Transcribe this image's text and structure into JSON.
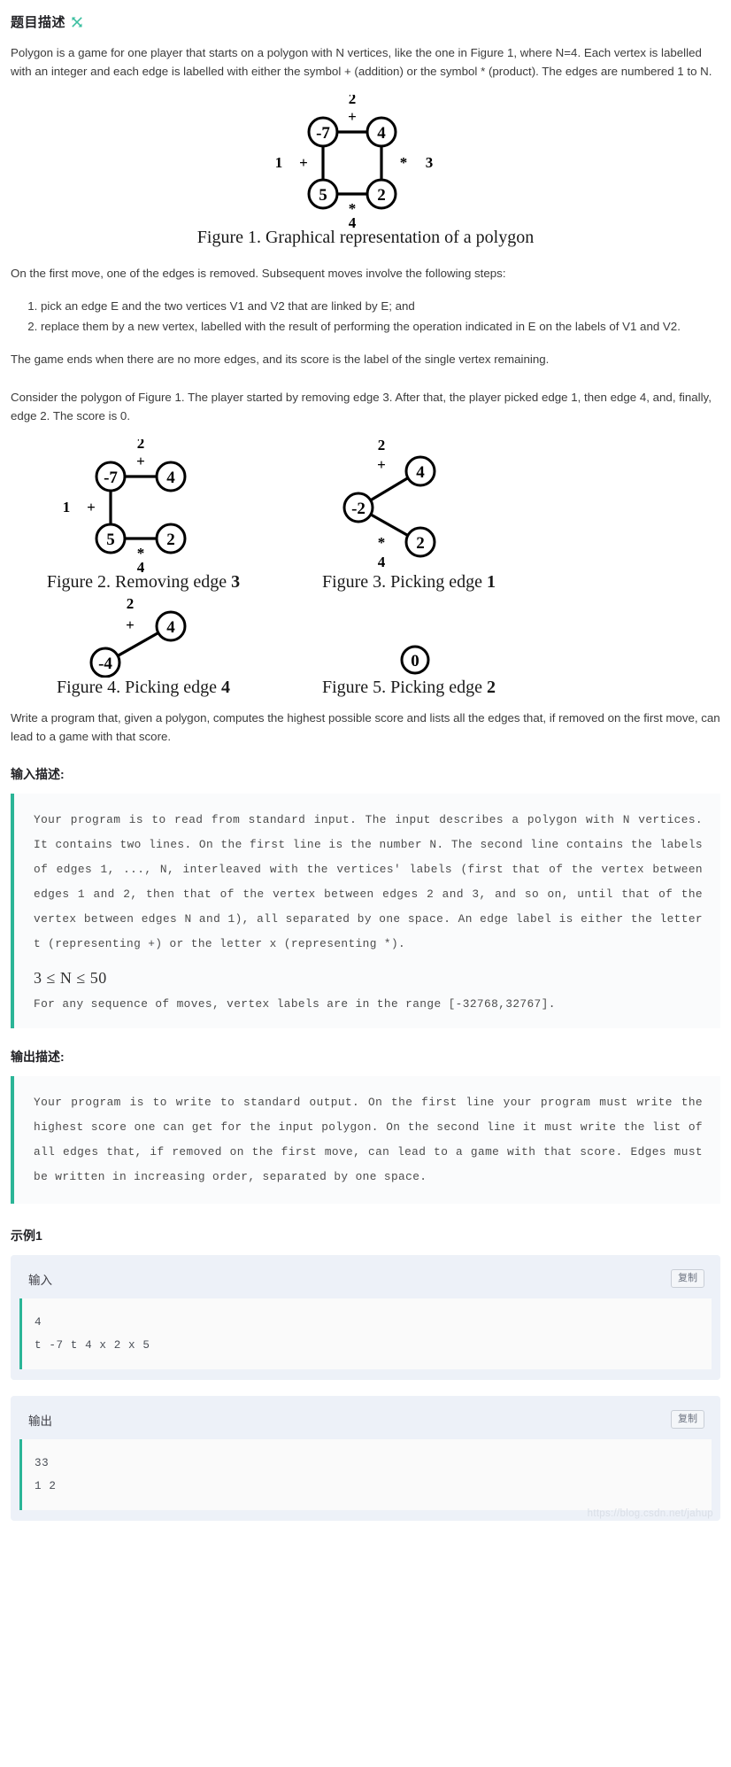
{
  "header": {
    "title": "题目描述",
    "anchor_icon": "link-anchor-icon"
  },
  "intro": {
    "p1": "Polygon is a game for one player that starts on a polygon with N vertices, like the one in Figure 1, where N=4. Each vertex is labelled with an integer and each edge is labelled with either the symbol + (addition) or the symbol * (product). The edges are numbered 1 to N.",
    "p2": "On the first move, one of the edges is removed. Subsequent moves involve the following steps:",
    "steps": [
      "pick an edge E and the two vertices V1 and V2 that are linked by E; and",
      "replace them by a new vertex, labelled with the result of performing the operation indicated in E on the labels of V1 and V2."
    ],
    "p3": "The game ends when there are no more edges, and its score is the label of the single vertex remaining.",
    "p4": "Consider the polygon of Figure 1. The player started by removing edge 3. After that, the player picked edge 1, then edge 4, and, finally, edge 2. The score is 0.",
    "p5": "Write a program that, given a polygon, computes the highest possible score and lists all the edges that, if removed on the first move, can lead to a game with that score."
  },
  "figures": {
    "fig1": {
      "caption_prefix": "Figure 1. Graphical representation of a polygon",
      "vertices": [
        "-7",
        "4",
        "5",
        "2"
      ],
      "edge_numbers": [
        "2",
        "3",
        "4",
        "1"
      ],
      "edge_ops": [
        "+",
        "*",
        "*",
        "+"
      ]
    },
    "fig2": {
      "caption_prefix": "Figure 2. Removing edge ",
      "caption_bold": "3",
      "vertices": [
        "-7",
        "4",
        "5",
        "2"
      ],
      "edge_numbers": [
        "2",
        "4",
        "1"
      ],
      "edge_ops": [
        "+",
        "*",
        "+"
      ]
    },
    "fig3": {
      "caption_prefix": "Figure 3. Picking edge ",
      "caption_bold": "1",
      "vertices": [
        "-2",
        "4",
        "2"
      ],
      "edge_numbers": [
        "2",
        "4"
      ],
      "edge_ops": [
        "+",
        "*"
      ]
    },
    "fig4": {
      "caption_prefix": "Figure 4. Picking edge ",
      "caption_bold": "4",
      "vertices": [
        "-4",
        "4"
      ],
      "edge_numbers": [
        "2"
      ],
      "edge_ops": [
        "+"
      ]
    },
    "fig5": {
      "caption_prefix": "Figure 5. Picking edge ",
      "caption_bold": "2",
      "vertices": [
        "0"
      ],
      "edge_numbers": [],
      "edge_ops": []
    }
  },
  "input_section": {
    "title": "输入描述:",
    "text": "Your program is to read from standard input. The input describes a polygon with N vertices. It contains two lines. On the first line is the number N. The second line contains the labels of edges 1, ..., N, interleaved with the vertices' labels (first that of the vertex between edges 1 and 2, then that of the vertex between edges 2 and 3, and so on, until that of the vertex between edges N and 1), all separated by one space. An edge label is either the letter t (representing +) or the letter x (representing *).",
    "constraint": "3 ≤ N ≤ 50",
    "range_note": "For any sequence of moves, vertex labels are in the range [-32768,32767]."
  },
  "output_section": {
    "title": "输出描述:",
    "text": "Your program is to write to standard output. On the first line your program must write the highest score one can get for the input polygon. On the second line it must write the list of all edges that, if removed on the first move, can lead to a game with that score. Edges must be written in increasing order, separated by one space."
  },
  "example": {
    "title": "示例1",
    "input_label": "输入",
    "input_copy": "复制",
    "input_value": "4\nt -7 t 4 x 2 x 5",
    "output_label": "输出",
    "output_copy": "复制",
    "output_value": "33\n1 2"
  },
  "watermark": "https://blog.csdn.net/jahup",
  "colors": {
    "accent_green": "#2bb597",
    "sample_bg": "#edf1f8",
    "text": "#3b3b3b"
  }
}
